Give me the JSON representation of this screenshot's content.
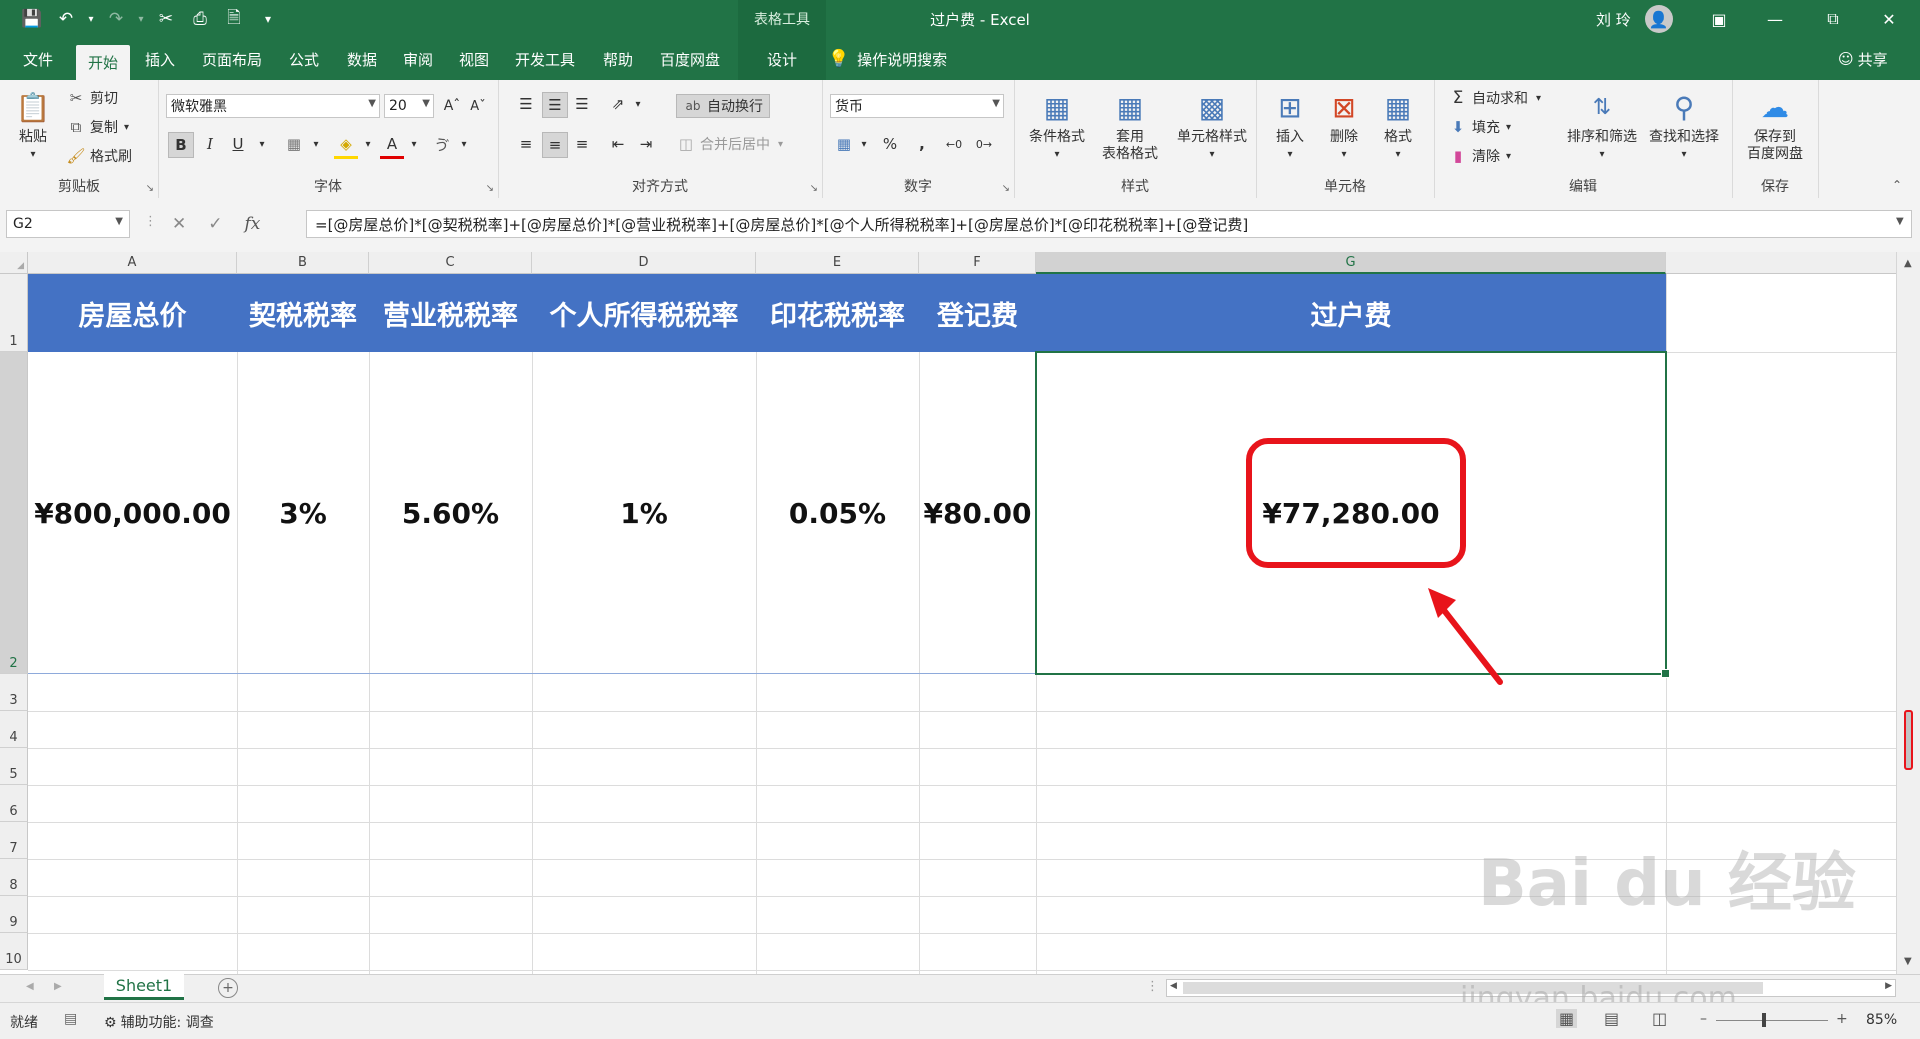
{
  "titlebar": {
    "table_tools": "表格工具",
    "title": "过户费 - Excel",
    "user": "刘 玲"
  },
  "tabs": [
    "文件",
    "开始",
    "插入",
    "页面布局",
    "公式",
    "数据",
    "审阅",
    "视图",
    "开发工具",
    "帮助",
    "百度网盘",
    "设计"
  ],
  "tell_me": "操作说明搜索",
  "share": "共享",
  "ribbon": {
    "clipboard": {
      "paste": "粘贴",
      "cut": "剪切",
      "copy": "复制",
      "format_painter": "格式刷",
      "label": "剪贴板"
    },
    "font": {
      "name": "微软雅黑",
      "size": "20",
      "label": "字体",
      "bold": "B",
      "italic": "I",
      "underline": "U"
    },
    "alignment": {
      "wrap": "自动换行",
      "merge": "合并后居中",
      "label": "对齐方式"
    },
    "number": {
      "format": "货币",
      "percent": "%",
      "comma": ",",
      "label": "数字"
    },
    "styles": {
      "cond": "条件格式",
      "table_l1": "套用",
      "table_l2": "表格格式",
      "cell": "单元格样式",
      "label": "样式"
    },
    "cells": {
      "insert": "插入",
      "delete": "删除",
      "format": "格式",
      "label": "单元格"
    },
    "editing": {
      "autosum": "自动求和",
      "fill": "填充",
      "clear": "清除",
      "sort": "排序和筛选",
      "find": "查找和选择",
      "label": "编辑"
    },
    "save": {
      "l1": "保存到",
      "l2": "百度网盘",
      "label": "保存"
    }
  },
  "namebox": "G2",
  "fx": "fx",
  "formula": "=[@房屋总价]*[@契税税率]+[@房屋总价]*[@营业税税率]+[@房屋总价]*[@个人所得税税率]+[@房屋总价]*[@印花税税率]+[@登记费]",
  "columns": [
    "A",
    "B",
    "C",
    "D",
    "E",
    "F",
    "G"
  ],
  "rows": [
    "1",
    "2",
    "3",
    "4",
    "5",
    "6",
    "7",
    "8",
    "9",
    "10"
  ],
  "headers": [
    "房屋总价",
    "契税税率",
    "营业税税率",
    "个人所得税税率",
    "印花税税率",
    "登记费",
    "过户费"
  ],
  "values": [
    "¥800,000.00",
    "3%",
    "5.60%",
    "1%",
    "0.05%",
    "¥80.00",
    "¥77,280.00"
  ],
  "sheet": "Sheet1",
  "status": {
    "ready": "就绪",
    "accessibility": "辅助功能: 调查",
    "zoom": "85%"
  },
  "watermark": {
    "brand": "Bai du 经验",
    "url": "jingyan.baidu.com"
  },
  "colors": {
    "excel_green": "#217346",
    "header_blue": "#4472c4",
    "highlight_red": "#e8141b"
  }
}
